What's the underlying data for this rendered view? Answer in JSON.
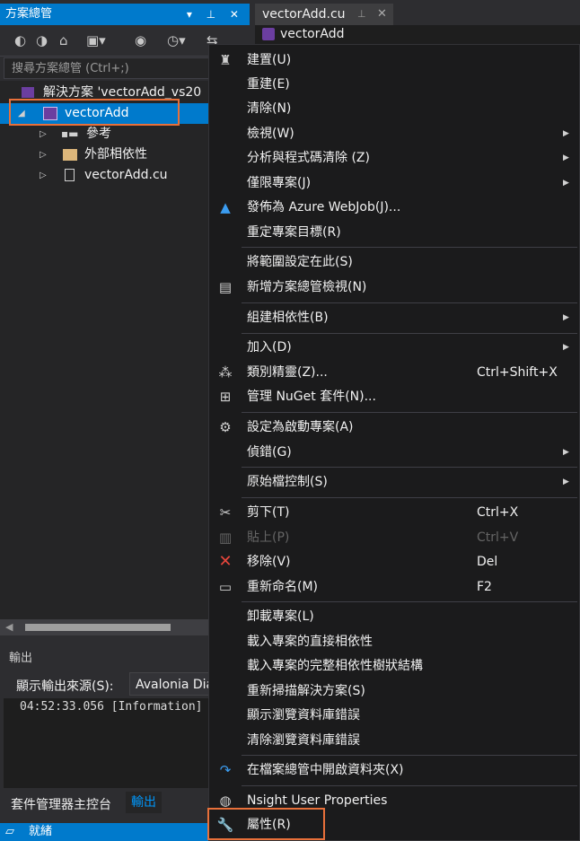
{
  "solution_explorer": {
    "title": "方案總管",
    "title_buttons": "▾ ⊥ ✕",
    "search_placeholder": "搜尋方案總管 (Ctrl+;)",
    "tree": {
      "solution": "解決方案 'vectorAdd_vs20",
      "project": "vectorAdd",
      "references": "參考",
      "external_deps": "外部相依性",
      "file": "vectorAdd.cu"
    }
  },
  "output": {
    "title": "輸出",
    "source_label": "顯示輸出來源(S):",
    "source_value": "Avalonia Dia",
    "log_line": "04:52:33.056 [Information]"
  },
  "bottom_tabs": {
    "package_manager": "套件管理器主控台",
    "output": "輸出"
  },
  "status": {
    "text": "就緒"
  },
  "editor": {
    "tab_title": "vectorAdd.cu",
    "tab_pin": "⊥",
    "tab_close": "✕",
    "project_label": "vectorAdd"
  },
  "context_menu": {
    "items": [
      {
        "label": "建置(U)",
        "icon": "build-icon"
      },
      {
        "label": "重建(E)"
      },
      {
        "label": "清除(N)"
      },
      {
        "label": "檢視(W)",
        "submenu": true
      },
      {
        "label": "分析與程式碼清除 (Z)",
        "submenu": true
      },
      {
        "label": "僅限專案(J)",
        "submenu": true
      },
      {
        "label": "發佈為 Azure WebJob(J)...",
        "icon": "azure-icon"
      },
      {
        "label": "重定專案目標(R)"
      },
      {
        "label": "將範圍設定在此(S)"
      },
      {
        "label": "新增方案總管檢視(N)",
        "icon": "new-view-icon"
      },
      {
        "label": "組建相依性(B)",
        "submenu": true
      },
      {
        "label": "加入(D)",
        "submenu": true
      },
      {
        "label": "類別精靈(Z)...",
        "shortcut": "Ctrl+Shift+X",
        "icon": "class-wizard-icon"
      },
      {
        "label": "管理 NuGet 套件(N)...",
        "icon": "nuget-icon"
      },
      {
        "label": "設定為啟動專案(A)",
        "icon": "gear-icon"
      },
      {
        "label": "偵錯(G)",
        "submenu": true
      },
      {
        "label": "原始檔控制(S)",
        "submenu": true
      },
      {
        "label": "剪下(T)",
        "shortcut": "Ctrl+X",
        "icon": "scissors-icon"
      },
      {
        "label": "貼上(P)",
        "shortcut": "Ctrl+V",
        "icon": "paste-icon",
        "disabled": true
      },
      {
        "label": "移除(V)",
        "shortcut": "Del",
        "icon": "remove-icon"
      },
      {
        "label": "重新命名(M)",
        "shortcut": "F2",
        "icon": "rename-icon"
      },
      {
        "label": "卸載專案(L)"
      },
      {
        "label": "載入專案的直接相依性"
      },
      {
        "label": "載入專案的完整相依性樹狀結構"
      },
      {
        "label": "重新掃描解決方案(S)"
      },
      {
        "label": "顯示瀏覽資料庫錯誤"
      },
      {
        "label": "清除瀏覽資料庫錯誤"
      },
      {
        "label": "在檔案總管中開啟資料夾(X)",
        "icon": "refresh-arrow-icon"
      },
      {
        "label": "Nsight User Properties",
        "icon": "nsight-icon"
      },
      {
        "label": "屬性(R)",
        "icon": "wrench-icon"
      }
    ]
  },
  "colors": {
    "accent": "#007acc",
    "highlight_box": "#e8703a",
    "remove_icon": "#e8463c",
    "azure_icon": "#3b9cf0"
  }
}
